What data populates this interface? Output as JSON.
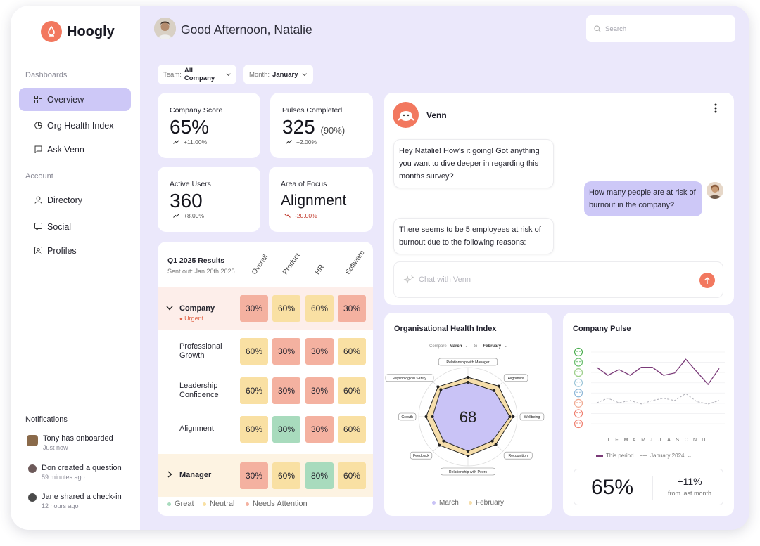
{
  "app": {
    "name": "Hoogly"
  },
  "sidebar": {
    "dashboards_label": "Dashboards",
    "account_label": "Account",
    "items": [
      {
        "label": "Overview",
        "icon": "grid-icon",
        "active": true
      },
      {
        "label": "Org Health Index",
        "icon": "pie-chart-icon"
      },
      {
        "label": "Ask Venn",
        "icon": "chat-icon"
      },
      {
        "label": "Directory",
        "icon": "users-icon"
      },
      {
        "label": "Social",
        "icon": "message-icon"
      },
      {
        "label": "Profiles",
        "icon": "profile-icon"
      }
    ]
  },
  "notifications": {
    "title": "Notifications",
    "items": [
      {
        "text": "Tony has onboarded",
        "time": "Just now"
      },
      {
        "text": "Don created a question",
        "time": "59 minutes ago"
      },
      {
        "text": "Jane shared a check-in",
        "time": "12 hours ago"
      }
    ]
  },
  "header": {
    "greeting": "Good Afternoon, Natalie",
    "search_placeholder": "Search"
  },
  "filters": {
    "team_label": "Team:",
    "team_value": "All Company",
    "month_label": "Month:",
    "month_value": "January"
  },
  "stats": {
    "company_score": {
      "label": "Company Score",
      "value": "65%",
      "delta": "+11.00%"
    },
    "pulses": {
      "label": "Pulses Completed",
      "value": "325",
      "suffix": "(90%)",
      "delta": "+2.00%"
    },
    "active_users": {
      "label": "Active Users",
      "value": "360",
      "delta": "+8.00%"
    },
    "focus": {
      "label": "Area of Focus",
      "value": "Alignment",
      "delta": "-20.00%"
    }
  },
  "results": {
    "title": "Q1 2025 Results",
    "subtitle": "Sent out: Jan 20th 2025",
    "columns": [
      "Overall",
      "Product",
      "HR",
      "Software"
    ],
    "company": {
      "label": "Company",
      "tag": "Urgent",
      "values": [
        "30%",
        "60%",
        "60%",
        "30%"
      ]
    },
    "rows": [
      {
        "label": "Professional Growth",
        "values": [
          "60%",
          "30%",
          "30%",
          "60%"
        ]
      },
      {
        "label": "Leadership Confidence",
        "values": [
          "60%",
          "30%",
          "30%",
          "60%"
        ]
      },
      {
        "label": "Alignment",
        "values": [
          "60%",
          "80%",
          "30%",
          "60%"
        ]
      }
    ],
    "manager": {
      "label": "Manager",
      "values": [
        "30%",
        "60%",
        "80%",
        "60%"
      ]
    },
    "legend": [
      "Great",
      "Neutral",
      "Needs Attention"
    ],
    "colors": {
      "great": "#a8dbbd",
      "neutral": "#f9e0a3",
      "attention": "#f4b1a0"
    }
  },
  "venn": {
    "name": "Venn",
    "messages": [
      {
        "from": "bot",
        "text": "Hey Natalie! How's it going! Got anything you want to dive deeper in regarding this months survey?"
      },
      {
        "from": "user",
        "text": "How many people are at risk of burnout in the company?"
      },
      {
        "from": "bot",
        "text": "There seems to be 5 employees at risk of burnout due to the following reasons:"
      }
    ],
    "input_placeholder": "Chat with Venn"
  },
  "ohi": {
    "title": "Organisational Health Index",
    "compare_label": "Compare",
    "compare_a": "March",
    "compare_to": "to",
    "compare_b": "February",
    "score": "68",
    "legend": [
      "March",
      "February"
    ]
  },
  "pulse": {
    "title": "Company Pulse",
    "months": [
      "J",
      "F",
      "M",
      "A",
      "M",
      "J",
      "J",
      "A",
      "S",
      "O",
      "N",
      "D"
    ],
    "legend_this": "This period",
    "legend_prev": "January 2024",
    "score": "65%",
    "delta": "+11%",
    "delta_label": "from last month"
  },
  "chart_data": [
    {
      "type": "radar",
      "title": "Organisational Health Index",
      "axes": [
        "Relationship with Manager",
        "Alignment",
        "Wellbeing",
        "Recognition",
        "Relationship with Peers",
        "Feedback",
        "Growth",
        "Psychological Safety"
      ],
      "series": [
        {
          "name": "March",
          "values": [
            0.7,
            0.75,
            0.85,
            0.7,
            0.7,
            0.7,
            0.72,
            0.78
          ],
          "color": "#c9c3f6"
        },
        {
          "name": "February",
          "values": [
            0.8,
            0.88,
            0.92,
            0.8,
            0.8,
            0.82,
            0.85,
            0.86
          ],
          "color": "#f6deab"
        }
      ],
      "center_value": "68"
    },
    {
      "type": "line",
      "title": "Company Pulse",
      "categories": [
        "J",
        "F",
        "M",
        "A",
        "M",
        "J",
        "J",
        "A",
        "S",
        "O",
        "N",
        "D"
      ],
      "ylim": [
        0,
        7
      ],
      "series": [
        {
          "name": "This period",
          "values": [
            5.3,
            4.6,
            5.1,
            4.6,
            5.3,
            5.3,
            4.6,
            4.8,
            6.0,
            4.9,
            3.8,
            5.2
          ],
          "color": "#7a3a78"
        },
        {
          "name": "January 2024",
          "values": [
            2.2,
            2.6,
            2.2,
            2.4,
            2.1,
            2.4,
            2.6,
            2.4,
            3.0,
            2.3,
            2.1,
            2.4
          ],
          "color": "#b0b0b8"
        }
      ]
    }
  ]
}
